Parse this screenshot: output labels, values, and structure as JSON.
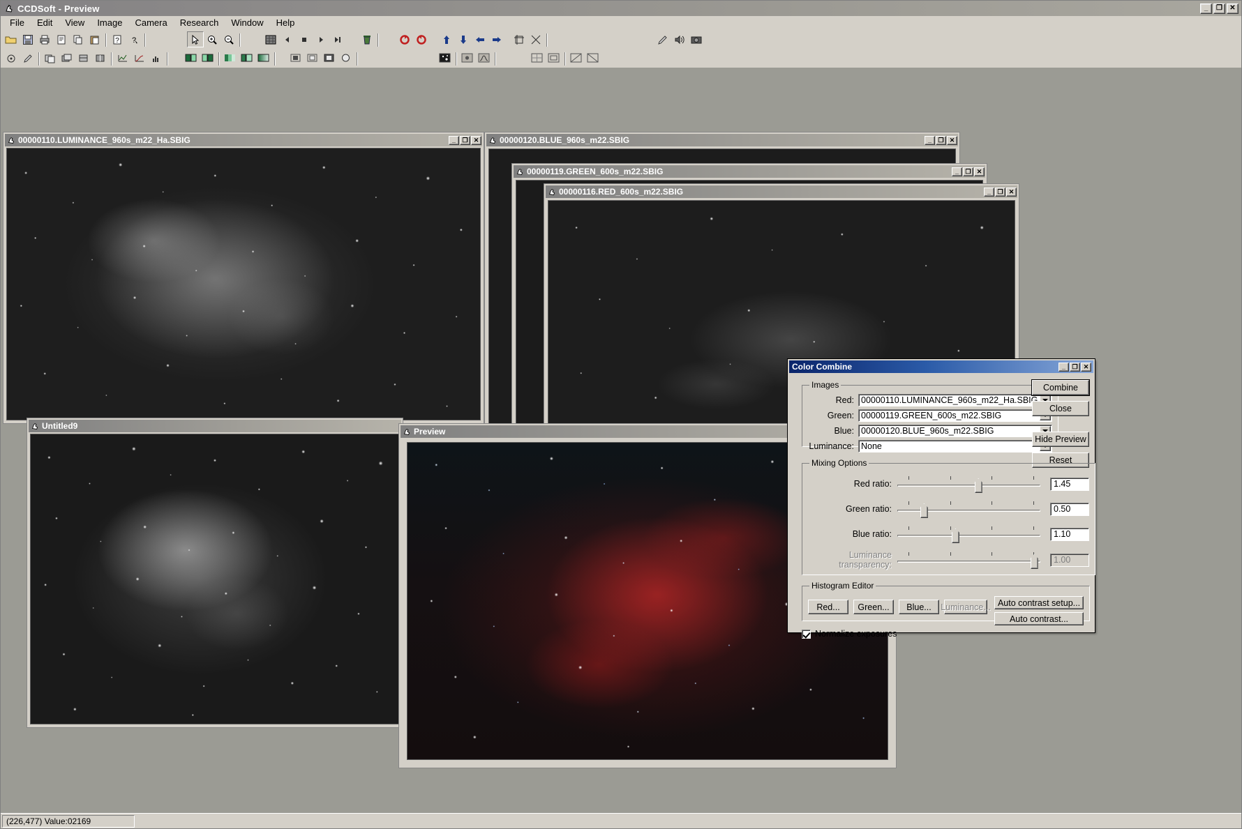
{
  "app": {
    "title": "CCDSoft  - Preview",
    "icon": "ccdsoft-icon",
    "window_buttons": [
      "minimize",
      "maximize",
      "close"
    ]
  },
  "menubar": {
    "items": [
      {
        "label": "File"
      },
      {
        "label": "Edit"
      },
      {
        "label": "View"
      },
      {
        "label": "Image"
      },
      {
        "label": "Camera"
      },
      {
        "label": "Research"
      },
      {
        "label": "Window"
      },
      {
        "label": "Help"
      }
    ]
  },
  "toolbar_row1": {
    "icons": [
      "open-folder-icon",
      "save-icon",
      "print-icon",
      "print-preview-icon",
      "copy-icon",
      "paste-icon",
      "help-icon",
      "context-help-icon",
      "pointer-icon",
      "zoom-in-icon",
      "zoom-out-icon",
      "grid-icon",
      "prev-frame-icon",
      "stop-icon",
      "next-frame-icon",
      "last-frame-icon",
      "trash-icon",
      "rotate-left-icon",
      "rotate-right-icon",
      "arrow-up-icon",
      "arrow-down-icon",
      "arrow-left-icon",
      "arrow-right-icon",
      "crop-icon",
      "resize-icon",
      "pencil-icon",
      "sound-icon",
      "camera-icon"
    ]
  },
  "toolbar_row2": {
    "icons": [
      "circle-tool-icon",
      "pen-tool-icon",
      "copy-image-icon",
      "stack-icon",
      "layers-icon",
      "align-icon",
      "graph-icon",
      "curve-icon",
      "histogram-icon",
      "contrast-a-icon",
      "contrast-b-icon",
      "palette-icon",
      "color-combine-icon",
      "gradient-icon",
      "square-dark-icon",
      "square-mid-icon",
      "square-light-icon",
      "circle-icon",
      "star-find-icon",
      "star-mask-icon",
      "star-profile-icon",
      "grid-a-icon",
      "grid-b-icon",
      "grid-c-icon",
      "grid-d-icon"
    ]
  },
  "windows": [
    {
      "id": "luminance",
      "title": "00000110.LUMINANCE_960s_m22_Ha.SBIG",
      "icon": "image-window-icon",
      "buttons": [
        "minimize",
        "maximize",
        "close"
      ]
    },
    {
      "id": "blue",
      "title": "00000120.BLUE_960s_m22.SBIG",
      "icon": "image-window-icon",
      "buttons": [
        "minimize",
        "maximize",
        "close"
      ]
    },
    {
      "id": "green",
      "title": "00000119.GREEN_600s_m22.SBIG",
      "icon": "image-window-icon",
      "buttons": [
        "minimize",
        "maximize",
        "close"
      ]
    },
    {
      "id": "red",
      "title": "00000116.RED_600s_m22.SBIG",
      "icon": "image-window-icon",
      "buttons": [
        "minimize",
        "maximize",
        "close"
      ]
    },
    {
      "id": "untitled9",
      "title": "Untitled9",
      "icon": "image-window-icon",
      "buttons": []
    },
    {
      "id": "preview",
      "title": "Preview",
      "icon": "image-window-icon",
      "buttons": []
    }
  ],
  "dialog": {
    "title": "Color Combine",
    "window_buttons": [
      "minimize",
      "maximize",
      "close"
    ],
    "images_group": {
      "legend": "Images",
      "fields": [
        {
          "label": "Red:",
          "value": "00000110.LUMINANCE_960s_m22_Ha.SBIG"
        },
        {
          "label": "Green:",
          "value": "00000119.GREEN_600s_m22.SBIG"
        },
        {
          "label": "Blue:",
          "value": "00000120.BLUE_960s_m22.SBIG"
        },
        {
          "label": "Luminance:",
          "value": "None"
        }
      ]
    },
    "mixing_group": {
      "legend": "Mixing Options",
      "sliders": [
        {
          "label": "Red ratio:",
          "value": "1.45",
          "pos_pct": 54,
          "disabled": false
        },
        {
          "label": "Green ratio:",
          "value": "0.50",
          "pos_pct": 16,
          "disabled": false
        },
        {
          "label": "Blue ratio:",
          "value": "1.10",
          "pos_pct": 38,
          "disabled": false
        },
        {
          "label": "Luminance transparency:",
          "value": "1.00",
          "pos_pct": 96,
          "disabled": true
        }
      ]
    },
    "histogram_group": {
      "legend": "Histogram Editor",
      "buttons": [
        {
          "label": "Red...",
          "disabled": false
        },
        {
          "label": "Green...",
          "disabled": false
        },
        {
          "label": "Blue...",
          "disabled": false
        },
        {
          "label": "Luminance...",
          "disabled": true
        }
      ],
      "right_buttons": [
        {
          "label": "Auto contrast setup...",
          "disabled": false
        },
        {
          "label": "Auto contrast...",
          "disabled": false
        }
      ]
    },
    "normalize": {
      "label": "Normalize exposures",
      "checked": true
    },
    "actions": [
      {
        "label": "Combine",
        "default": true
      },
      {
        "label": "Close",
        "default": false
      },
      {
        "label": "Hide Preview",
        "default": false
      },
      {
        "label": "Reset",
        "default": false
      }
    ]
  },
  "statusbar": {
    "text": "(226,477) Value:02169"
  }
}
